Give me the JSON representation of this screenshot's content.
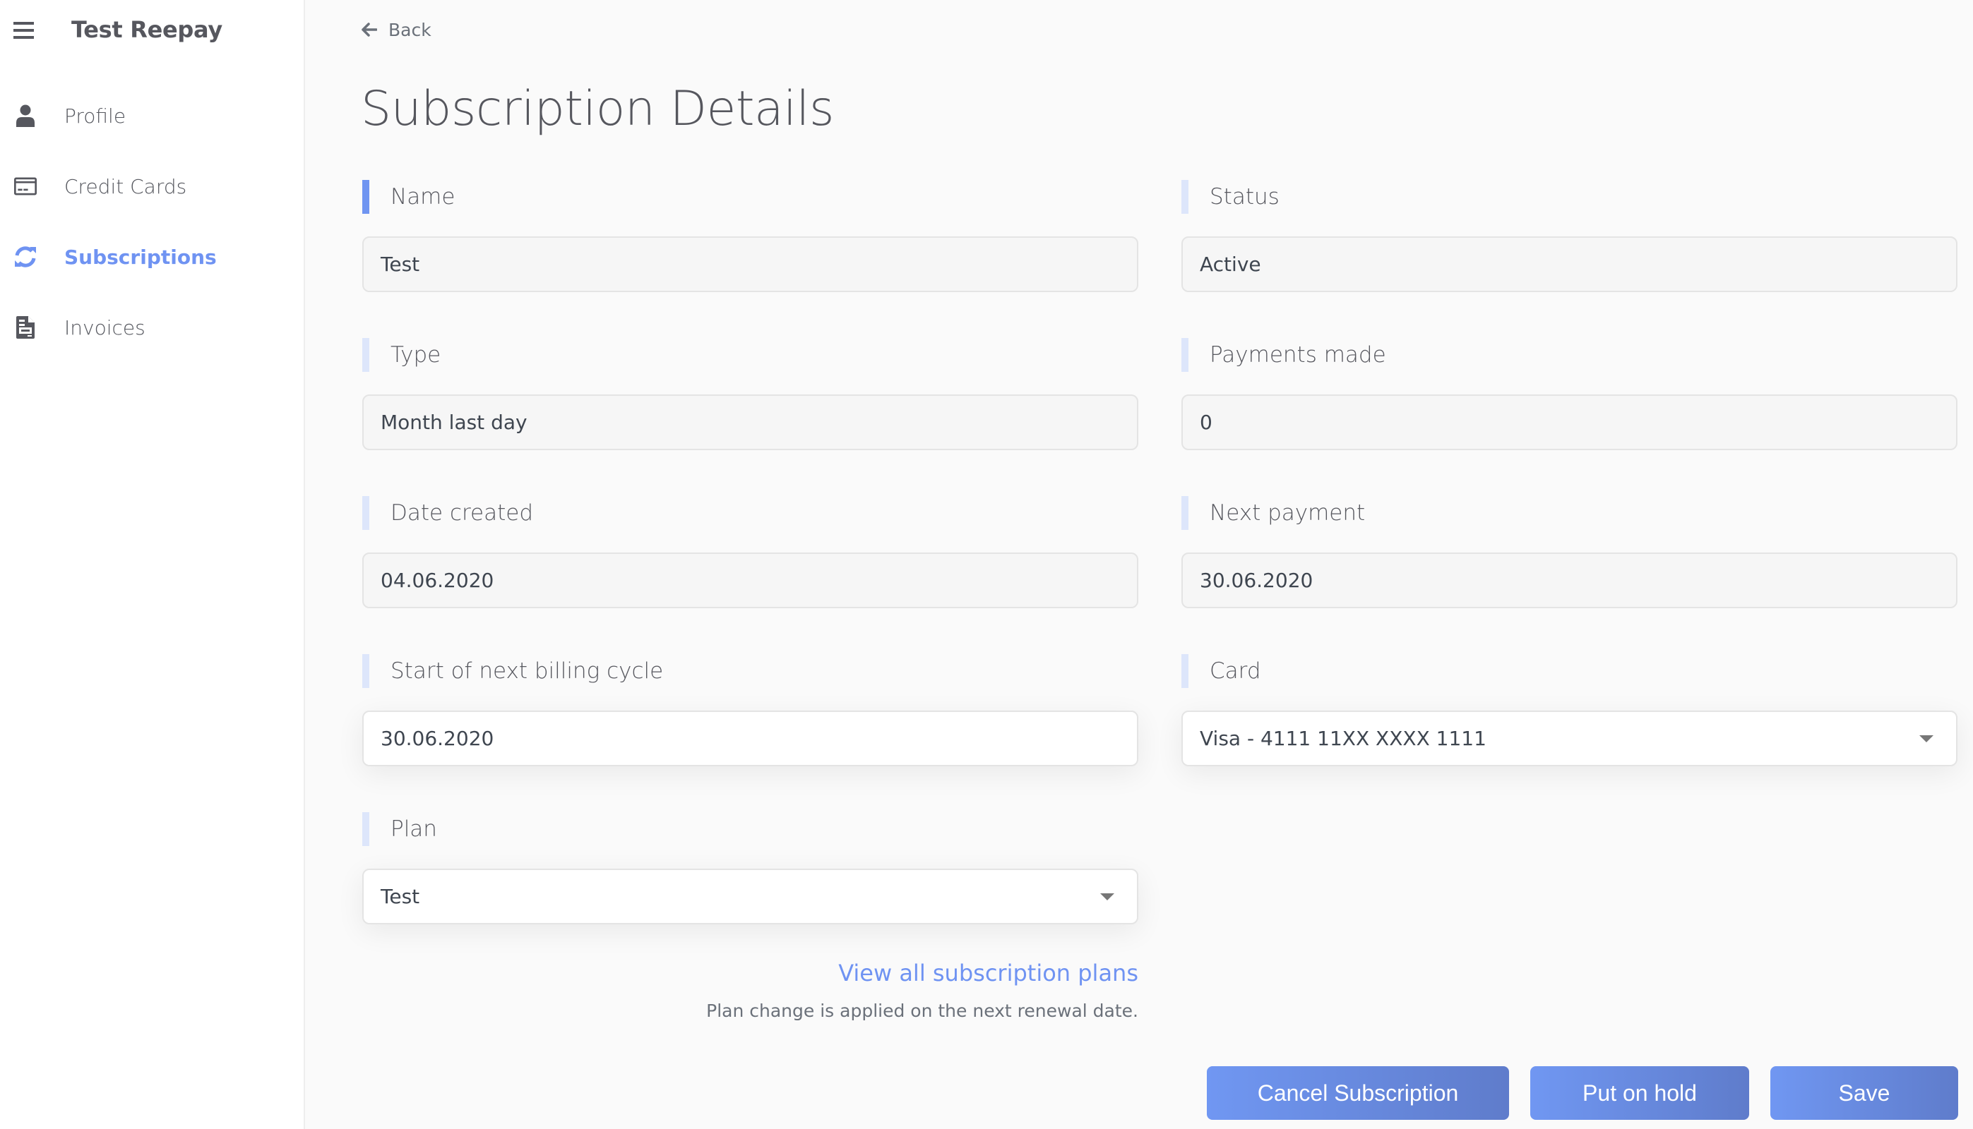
{
  "sidebar": {
    "app_title": "Test Reepay",
    "menu_icon": "hamburger-menu-icon",
    "items": [
      {
        "label": "Profile",
        "icon": "user-icon",
        "active": false
      },
      {
        "label": "Credit Cards",
        "icon": "credit-card-icon",
        "active": false
      },
      {
        "label": "Subscriptions",
        "icon": "refresh-icon",
        "active": true
      },
      {
        "label": "Invoices",
        "icon": "document-icon",
        "active": false
      }
    ]
  },
  "header": {
    "back_label": "Back",
    "back_icon": "arrow-left-icon",
    "title": "Subscription Details"
  },
  "form": {
    "name": {
      "label": "Name",
      "value": "Test"
    },
    "status": {
      "label": "Status",
      "value": "Active"
    },
    "type": {
      "label": "Type",
      "value": "Month last day"
    },
    "payments_made": {
      "label": "Payments made",
      "value": "0"
    },
    "date_created": {
      "label": "Date created",
      "value": "04.06.2020"
    },
    "next_payment": {
      "label": "Next payment",
      "value": "30.06.2020"
    },
    "next_billing_cycle": {
      "label": "Start of next billing cycle",
      "value": "30.06.2020"
    },
    "card": {
      "label": "Card",
      "value": "Visa - 4111 11XX XXXX 1111"
    },
    "plan": {
      "label": "Plan",
      "value": "Test"
    }
  },
  "plans": {
    "link_label": "View all subscription plans",
    "note": "Plan change is applied on the next renewal date."
  },
  "actions": {
    "cancel_label": "Cancel Subscription",
    "hold_label": "Put on hold",
    "save_label": "Save"
  },
  "colors": {
    "accent": "#6f93f2",
    "button_gradient_start": "#7097f2",
    "button_gradient_end": "#5f7ccb",
    "label_bar": "#dde6fb",
    "label_bar_focused": "#7095f1"
  }
}
